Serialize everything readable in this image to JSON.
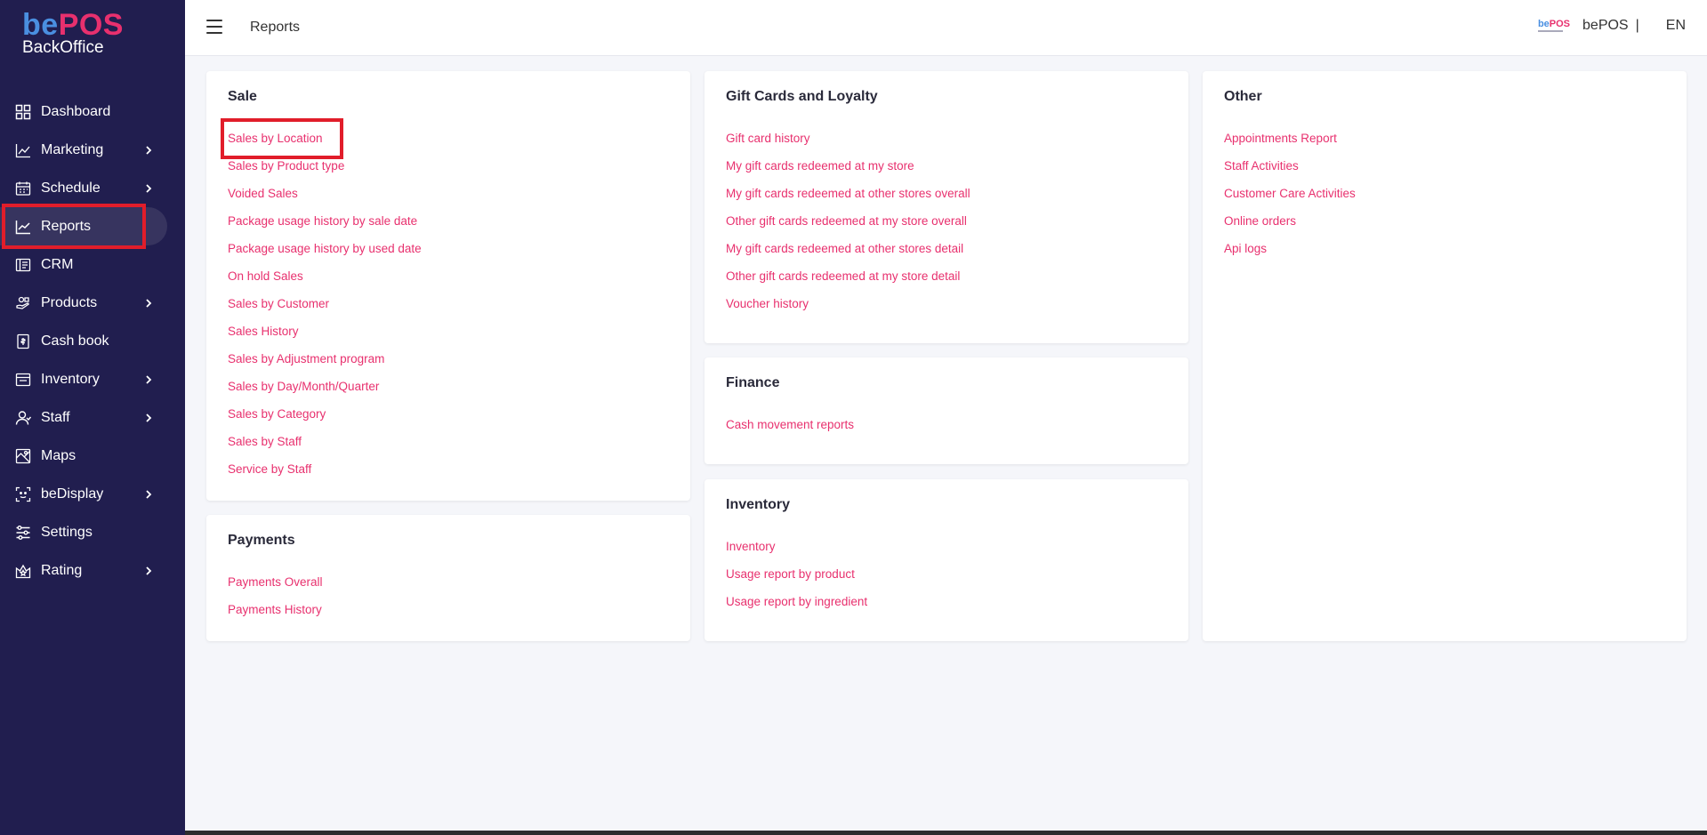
{
  "brand": {
    "logo_be": "be",
    "logo_pos": "POS",
    "logo_sub": "BackOffice"
  },
  "sidebar": {
    "items": [
      {
        "label": "Dashboard",
        "icon": "grid-icon",
        "has_children": false
      },
      {
        "label": "Marketing",
        "icon": "trend-icon",
        "has_children": true
      },
      {
        "label": "Schedule",
        "icon": "calendar-icon",
        "has_children": true
      },
      {
        "label": "Reports",
        "icon": "chart-icon",
        "has_children": false,
        "active": true
      },
      {
        "label": "CRM",
        "icon": "crm-icon",
        "has_children": false
      },
      {
        "label": "Products",
        "icon": "products-icon",
        "has_children": true
      },
      {
        "label": "Cash book",
        "icon": "cashbook-icon",
        "has_children": false
      },
      {
        "label": "Inventory",
        "icon": "inventory-icon",
        "has_children": true
      },
      {
        "label": "Staff",
        "icon": "staff-icon",
        "has_children": true
      },
      {
        "label": "Maps",
        "icon": "map-icon",
        "has_children": false
      },
      {
        "label": "beDisplay",
        "icon": "display-icon",
        "has_children": true
      },
      {
        "label": "Settings",
        "icon": "settings-icon",
        "has_children": false
      },
      {
        "label": "Rating",
        "icon": "rating-icon",
        "has_children": true
      }
    ]
  },
  "header": {
    "title": "Reports",
    "mini_logo_be": "be",
    "mini_logo_pos": "POS",
    "brand_name": "bePOS",
    "separator": "|",
    "language": "EN"
  },
  "cards": {
    "sale": {
      "title": "Sale",
      "links": [
        "Sales by Location",
        "Sales by Product type",
        "Voided Sales",
        "Package usage history by sale date",
        "Package usage history by used date",
        "On hold Sales",
        "Sales by Customer",
        "Sales History",
        "Sales by Adjustment program",
        "Sales by Day/Month/Quarter",
        "Sales by Category",
        "Sales by Staff",
        "Service by Staff"
      ]
    },
    "payments": {
      "title": "Payments",
      "links": [
        "Payments Overall",
        "Payments History"
      ]
    },
    "gift": {
      "title": "Gift Cards and Loyalty",
      "links": [
        "Gift card history",
        "My gift cards redeemed at my store",
        "My gift cards redeemed at other stores overall",
        "Other gift cards redeemed at my store overall",
        "My gift cards redeemed at other stores detail",
        "Other gift cards redeemed at my store detail",
        "Voucher history"
      ]
    },
    "finance": {
      "title": "Finance",
      "links": [
        "Cash movement reports"
      ]
    },
    "inventory": {
      "title": "Inventory",
      "links": [
        "Inventory",
        "Usage report by product",
        "Usage report by ingredient"
      ]
    },
    "other": {
      "title": "Other",
      "links": [
        "Appointments Report",
        "Staff Activities",
        "Customer Care Activities",
        "Online orders",
        "Api logs"
      ]
    }
  },
  "colors": {
    "sidebar_bg": "#211e4f",
    "link": "#e8306e",
    "highlight": "#e11d2a",
    "logo_blue": "#4a8fe0",
    "logo_pink": "#e8306e"
  }
}
